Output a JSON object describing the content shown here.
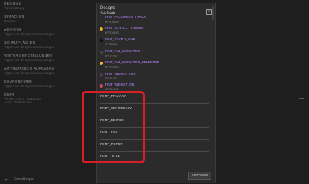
{
  "background": {
    "items": [
      {
        "title": "DESIGNS",
        "subtitle": "Vordersetzung"
      },
      {
        "title": "SPRACHEN",
        "subtitle": "Deutsch"
      },
      {
        "title": "ADD-ONS",
        "subtitle": "Tippen, um die Optionen anzuzeigen"
      },
      {
        "title": "SCHALTFLÄCHEN",
        "subtitle": "Tippen, um die Optionen anzuzeigen"
      },
      {
        "title": "WEITERE EINSTELLUNGEN",
        "subtitle": "Tippen, um die Optionen anzuzeigen"
      },
      {
        "title": "AUTOMATISCHE AUFGABEN",
        "subtitle": "Tippen, um die Optionen anzuzeigen"
      },
      {
        "title": "KOMPONENTEN",
        "subtitle": "Tippen, um die Optionen anzuzeigen"
      },
      {
        "title": "ÜBER",
        "subtitle": "Version 4.54.4 · 32404410"
      },
      {
        "title": "",
        "subtitle": "Autor: Thiebe Punia"
      }
    ],
    "bottom_label": "Einstellungen"
  },
  "dialog": {
    "title": "Designs",
    "subtitle": "SA Dark",
    "close_icon": "close-icon",
    "colors": [
      {
        "name": "FINT_PROGRESS_TRACK",
        "hex": "#FF5D4D53",
        "dot": "#8a5a3a"
      },
      {
        "name": "FINT_SCROLL_THUMBS",
        "hex": "#FF5D4D53",
        "dot": "#f0b429"
      },
      {
        "name": "FINT_STATUS_BAR",
        "hex": "#FF282828",
        "dot": "#111111"
      },
      {
        "name": "FINT_TAB_INDICATOR",
        "hex": "#FF2F2F2F",
        "dot": "#3a3a3a"
      },
      {
        "name": "FINT_TAB_INDICATOR_SELECTED",
        "hex": "#FFFCA030",
        "dot": "#f7b733"
      },
      {
        "name": "FINT_WIDGET_OFF",
        "hex": "#FF424242",
        "dot": "#4a3d55"
      },
      {
        "name": "FINT_WIDGET_ON",
        "hex": "#FF2A4B4B",
        "dot": "#d84a5c"
      }
    ],
    "fonts": [
      "FONT_PRIMARY",
      "FONT_SECONDARY",
      "FONT_EDITOR",
      "FONT_HEX",
      "FONT_POPUP",
      "FONT_TITLE"
    ],
    "save_label": "SPEICHERN"
  }
}
